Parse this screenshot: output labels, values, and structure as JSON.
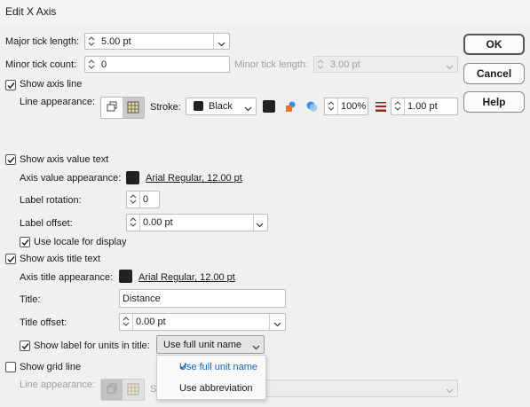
{
  "window": {
    "title": "Edit X Axis"
  },
  "buttons": {
    "ok": "OK",
    "cancel": "Cancel",
    "help": "Help"
  },
  "ticks": {
    "major_label": "Major tick length:",
    "major_value": "5.00 pt",
    "minor_count_label": "Minor tick count:",
    "minor_count_value": "0",
    "minor_length_label": "Minor tick length:",
    "minor_length_value": "3.00 pt"
  },
  "axis_line": {
    "show_label": "Show axis line",
    "checked": true,
    "appearance_label": "Line appearance:",
    "stroke_label": "Stroke:",
    "stroke_color_name": "Black",
    "stroke_color": "#1a1a1a",
    "opacity": "100%",
    "width": "1.00 pt"
  },
  "value_text": {
    "show_label": "Show axis value text",
    "checked": true,
    "appearance_label": "Axis value appearance:",
    "font_link": "Arial Regular, 12.00 pt",
    "rotation_label": "Label rotation:",
    "rotation_value": "0",
    "offset_label": "Label offset:",
    "offset_value": "0.00 pt",
    "locale_label": "Use locale for display",
    "locale_checked": true
  },
  "title_text": {
    "show_label": "Show axis title text",
    "checked": true,
    "appearance_label": "Axis title appearance:",
    "font_link": "Arial Regular, 12.00 pt",
    "title_label": "Title:",
    "title_value": "Distance",
    "offset_label": "Title offset:",
    "offset_value": "0.00 pt",
    "units_label": "Show label for units in title:",
    "units_checked": true,
    "units_value": "Use full unit name"
  },
  "grid_line": {
    "show_label": "Show grid  line",
    "checked": false,
    "appearance_label": "Line appearance:",
    "stroke_partial": "S"
  },
  "units_menu": {
    "options": [
      "Use full unit name",
      "Use abbreviation"
    ],
    "selected_index": 0
  },
  "colors": {
    "accent": "#1464c8",
    "orange": "#e8742a",
    "blue": "#3a8fe0",
    "red": "#a32020"
  }
}
